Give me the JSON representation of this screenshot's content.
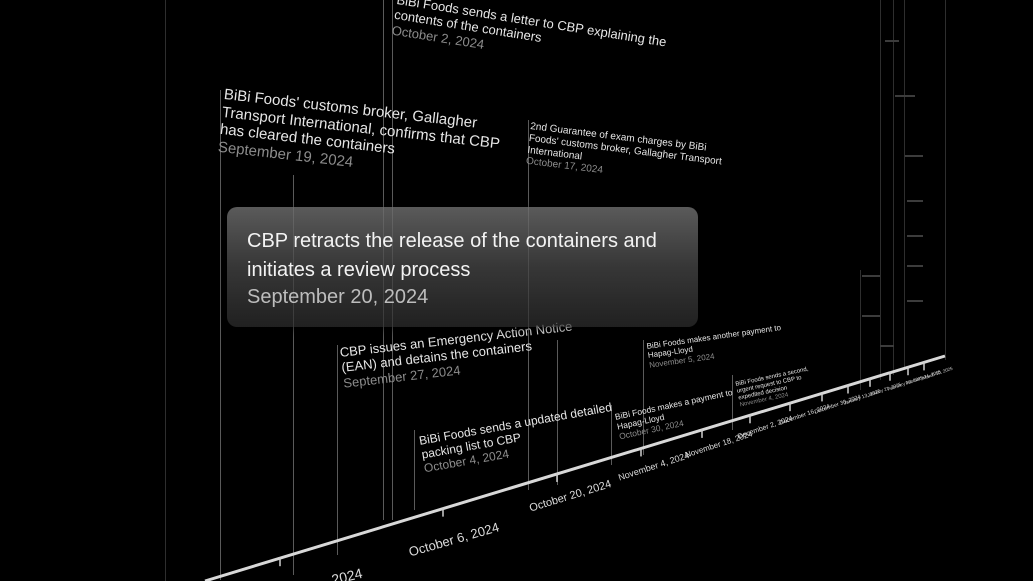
{
  "tooltip": {
    "title": "CBP retracts the release of the containers and initiates a review process",
    "date": "September 20, 2024"
  },
  "events": [
    {
      "title": "BiBi Foods sends a letter to CBP explaining the contents of the containers",
      "date": "October 2, 2024"
    },
    {
      "title": "BiBi Foods' customs broker, Gallagher Transport International, confirms that CBP has cleared the containers",
      "date": "September 19, 2024"
    },
    {
      "title": "2nd Guarantee of exam charges by BiBi Foods' customs broker, Gallagher Transport International",
      "date": "October 17, 2024"
    },
    {
      "title": "CBP issues an Emergency Action Notice (EAN) and detains the containers",
      "date": "September 27, 2024"
    },
    {
      "title": "BiBi Foods sends a updated detailed packing list to CBP",
      "date": "October 4, 2024"
    },
    {
      "title": "BiBi Foods makes another payment to Hapag-Lloyd",
      "date": "November 5, 2024"
    },
    {
      "title": "BiBi Foods makes a payment to Hapag-Lloyd",
      "date": "October 30, 2024"
    },
    {
      "title": "BiBi Foods sends a second, urgent request to CBP to expedited decision",
      "date": "November 4, 2024"
    }
  ],
  "axis": {
    "ticks": [
      "2024",
      "October 6, 2024",
      "October 20, 2024",
      "November 4, 2024",
      "November 18, 2024",
      "December 2, 2024",
      "December 16, 2024",
      "December 30, 2024",
      "January 13, 2025",
      "January 27, 2025",
      "February 10, 2025",
      "February 24, 2025",
      "March 10, 2025"
    ]
  }
}
